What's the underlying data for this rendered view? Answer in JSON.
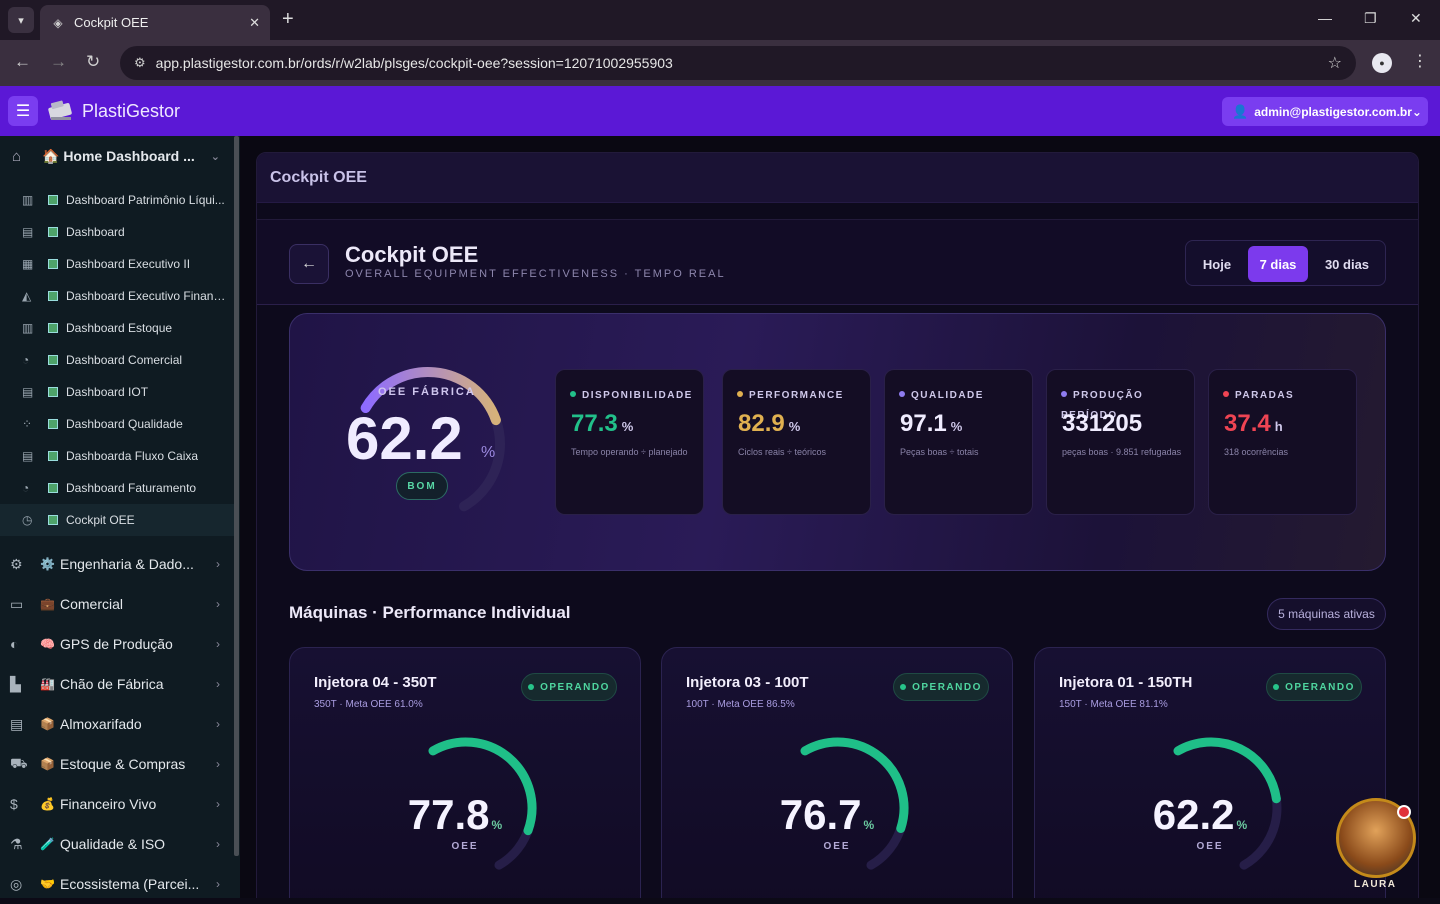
{
  "browser": {
    "tab_title": "Cockpit OEE",
    "url": "app.plastigestor.com.br/ords/r/w2lab/plsges/cockpit-oee?session=12071002955903"
  },
  "app": {
    "brand": "PlastiGestor",
    "user": "admin@plastigestor.com.br",
    "brand_color": "#5b18d6"
  },
  "sidebar": {
    "home": "🏠 Home Dashboard ...",
    "subitems": [
      {
        "label": "Dashboard Patrimônio Líqui...",
        "icon": "bar-group-icon"
      },
      {
        "label": "Dashboard",
        "icon": "bar-chart-icon"
      },
      {
        "label": "Dashboard Executivo II",
        "icon": "report-icon"
      },
      {
        "label": "Dashboard Executivo Financ...",
        "icon": "area-chart-icon"
      },
      {
        "label": "Dashboard Estoque",
        "icon": "bar-line-icon"
      },
      {
        "label": "Dashboard Comercial",
        "icon": "pie-chart-icon"
      },
      {
        "label": "Dashboard IOT",
        "icon": "bar-chart-icon"
      },
      {
        "label": "Dashboard Qualidade",
        "icon": "scatter-icon"
      },
      {
        "label": "Dashboarda Fluxo Caixa",
        "icon": "bar-chart-icon"
      },
      {
        "label": "Dashboard Faturamento",
        "icon": "pie-chart-icon"
      },
      {
        "label": "Cockpit OEE",
        "icon": "gauge-icon"
      }
    ],
    "main_items": [
      {
        "emoji": "⚙️",
        "label": "Engenharia & Dado...",
        "icon": "gears-icon"
      },
      {
        "emoji": "💼",
        "label": "Comercial",
        "icon": "briefcase-icon"
      },
      {
        "emoji": "🧠",
        "label": "GPS de Produção",
        "icon": "compass-icon"
      },
      {
        "emoji": "🏭",
        "label": "Chão de Fábrica",
        "icon": "factory-icon"
      },
      {
        "emoji": "📦",
        "label": "Almoxarifado",
        "icon": "archive-icon"
      },
      {
        "emoji": "📦",
        "label": "Estoque & Compras",
        "icon": "truck-icon"
      },
      {
        "emoji": "💰",
        "label": "Financeiro Vivo",
        "icon": "dollar-icon"
      },
      {
        "emoji": "🧪",
        "label": "Qualidade & ISO",
        "icon": "quality-icon"
      },
      {
        "emoji": "🤝",
        "label": "Ecossistema (Parcei...",
        "icon": "globe-icon"
      }
    ]
  },
  "page": {
    "panel_title": "Cockpit OEE",
    "title": "Cockpit OEE",
    "subtitle": "OVERALL EQUIPMENT EFFECTIVENESS · TEMPO REAL",
    "back_glyph": "←",
    "periods": [
      "Hoje",
      "7 dias",
      "30 dias"
    ],
    "active_period": "7 dias"
  },
  "hero": {
    "label": "OEE FÁBRICA",
    "value": "62.2",
    "unit": "%",
    "gauge_fraction": 0.622,
    "status": "BOM",
    "kpis": [
      {
        "title": "DISPONIBILIDADE",
        "value": "77.3",
        "unit": "%",
        "desc": "Tempo operando ÷ planejado",
        "color": "#22c08a"
      },
      {
        "title": "PERFORMANCE",
        "value": "82.9",
        "unit": "%",
        "desc": "Ciclos reais ÷ teóricos",
        "color": "#e0b050"
      },
      {
        "title": "QUALIDADE",
        "value": "97.1",
        "unit": "%",
        "desc": "Peças boas ÷ totais",
        "color": "#f0ecff"
      },
      {
        "title": "PRODUÇÃO PERÍODO",
        "value": "331205",
        "unit": "",
        "desc": "peças boas · 9.851 refugadas",
        "color": "#f0ecff"
      },
      {
        "title": "PARADAS",
        "value": "37.4",
        "unit": "h",
        "desc": "318 ocorrências",
        "color": "#ef4453"
      }
    ]
  },
  "machines": {
    "title": "Máquinas · Performance Individual",
    "active_label": "5 máquinas ativas",
    "items": [
      {
        "name": "Injetora 04 - 350T",
        "meta": "350T · Meta OEE 61.0%",
        "status": "OPERANDO",
        "value": "77.8",
        "unit": "%",
        "label": "OEE",
        "fraction": 0.778
      },
      {
        "name": "Injetora 03 - 100T",
        "meta": "100T · Meta OEE 86.5%",
        "status": "OPERANDO",
        "value": "76.7",
        "unit": "%",
        "label": "OEE",
        "fraction": 0.767
      },
      {
        "name": "Injetora 01 - 150TH",
        "meta": "150T · Meta OEE 81.1%",
        "status": "OPERANDO",
        "value": "62.2",
        "unit": "%",
        "label": "OEE",
        "fraction": 0.622
      }
    ]
  },
  "assistant": {
    "name": "LAURA"
  }
}
